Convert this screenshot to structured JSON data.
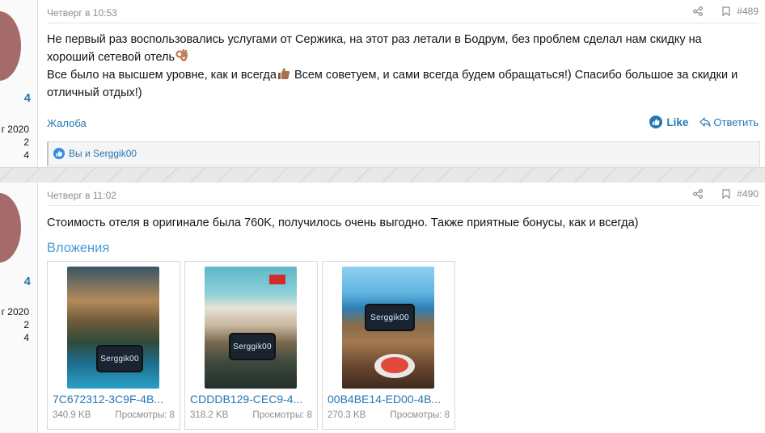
{
  "posts": [
    {
      "date": "Четверг в 10:53",
      "number": "#489",
      "sidebar": {
        "name_fragment": "4",
        "stat_line1": "г 2020",
        "stat_line2": "2",
        "stat_line3": "4"
      },
      "text_line1": "Не первый раз воспользовались услугами от Сержика, на этот раз летали в Бодрум, без проблем сделал нам скидку на",
      "text_line2": "хороший сетевой отель",
      "text_line3": "Все было на высшем уровне, как и всегда",
      "text_line3b": " Всем советуем, и сами всегда будем обращаться!) Спасибо большое за скидки и",
      "text_line4": "отличный отдых!)",
      "report_label": "Жалоба",
      "like_label": "Like",
      "reply_label": "Ответить",
      "likes_text": "Вы и Serggik00"
    },
    {
      "date": "Четверг в 11:02",
      "number": "#490",
      "sidebar": {
        "name_fragment": "4",
        "stat_line1": "г 2020",
        "stat_line2": "2",
        "stat_line3": "4"
      },
      "text": "Стоимость отеля в оригинале была 760K, получилось очень выгодно. Также приятные бонусы, как и всегда)",
      "attachments_title": "Вложения",
      "attachments": [
        {
          "filename": "7C672312-3C9F-4B...",
          "size": "340.9 KB",
          "views": "Просмотры: 8",
          "phone_text": "Serggik00"
        },
        {
          "filename": "CDDDB129-CEC9-4...",
          "size": "318.2 KB",
          "views": "Просмотры: 8",
          "phone_text": "Serggik00"
        },
        {
          "filename": "00B4BE14-ED00-4B...",
          "size": "270.3 KB",
          "views": "Просмотры: 8",
          "phone_text": "Serggik00"
        }
      ]
    }
  ],
  "icons": {
    "share": "share-icon",
    "bookmark": "bookmark-icon",
    "like": "thumbs-up-icon",
    "reply": "reply-icon"
  },
  "colors": {
    "link": "#2577b1",
    "attachments_title": "#4a9bd8",
    "muted": "#8c8c8c"
  }
}
